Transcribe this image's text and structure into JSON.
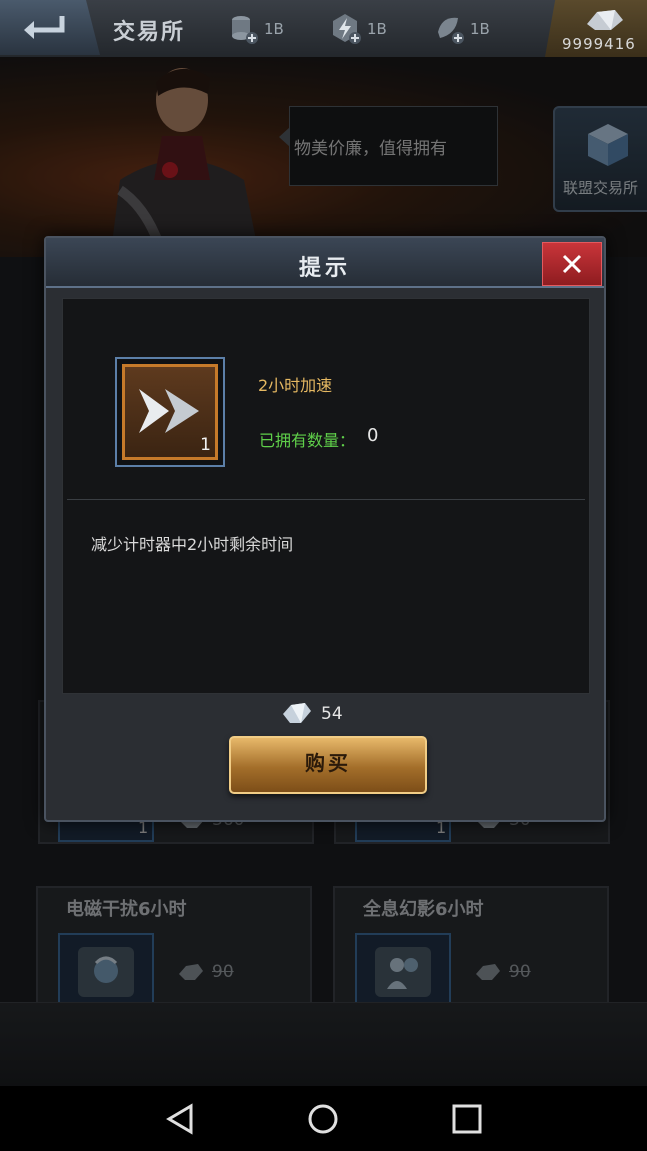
{
  "topbar": {
    "title": "交易所",
    "resources": [
      {
        "icon": "coin-stack-icon",
        "value": "1B"
      },
      {
        "icon": "energy-icon",
        "value": "1B"
      },
      {
        "icon": "crystal-icon",
        "value": "1B"
      }
    ],
    "diamonds": "9999416"
  },
  "hero": {
    "speech": "物美价廉，值得拥有",
    "alliance_label": "联盟交易所"
  },
  "shop": {
    "row_partial": [
      {
        "qty": "1",
        "price": "360"
      },
      {
        "qty": "1",
        "price": "30"
      }
    ],
    "cards": [
      {
        "title": "电磁干扰6小时",
        "price": "90"
      },
      {
        "title": "全息幻影6小时",
        "price": "90"
      }
    ]
  },
  "dialog": {
    "title": "提示",
    "item_name": "2小时加速",
    "item_qty": "1",
    "owned_label": "已拥有数量：",
    "owned_value": "0",
    "description": "减少计时器中2小时剩余时间",
    "price": "54",
    "buy_label": "购买"
  },
  "colors": {
    "accent_gold": "#e5b862",
    "owned_green": "#5fcf4a",
    "close_red": "#c9353a"
  }
}
